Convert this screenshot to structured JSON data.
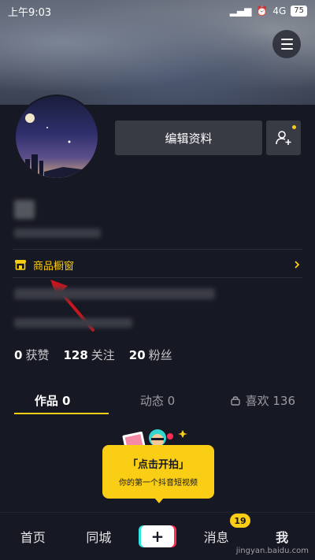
{
  "status_bar": {
    "time": "上午9:03",
    "network": "4G",
    "battery": "75"
  },
  "profile": {
    "edit_button": "编辑资料",
    "shop_window_label": "商品橱窗"
  },
  "stats": [
    {
      "number": "0",
      "label": "获赞"
    },
    {
      "number": "128",
      "label": "关注"
    },
    {
      "number": "20",
      "label": "粉丝"
    }
  ],
  "tabs": [
    {
      "label": "作品 0"
    },
    {
      "label": "动态 0"
    },
    {
      "label": "喜欢 136"
    }
  ],
  "promo": {
    "title": "「点击开拍」",
    "subtitle": "你的第一个抖音短视频"
  },
  "bottom_nav": {
    "home": "首页",
    "nearby": "同城",
    "plus": "+",
    "messages": "消息",
    "me": "我",
    "badge": "19"
  },
  "watermark": "jingyan.baidu.com",
  "colors": {
    "accent": "#face15",
    "background": "#161823",
    "button": "#393b44"
  },
  "icons": [
    "menu-icon",
    "add-friend-icon",
    "shop-icon",
    "chevron-right-icon",
    "lock-icon"
  ]
}
